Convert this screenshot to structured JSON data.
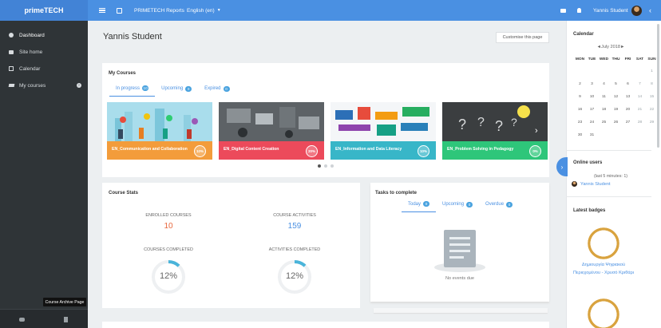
{
  "topbar": {
    "brand": "primeTECH",
    "reports_link": "PRIMETECH Reports",
    "language": "English (en)",
    "user_name": "Yannis Student"
  },
  "sidebar": {
    "items": [
      {
        "label": "Dashboard",
        "icon": "dashboard-icon"
      },
      {
        "label": "Site home",
        "icon": "home-icon"
      },
      {
        "label": "Calendar",
        "icon": "calendar-icon"
      },
      {
        "label": "My courses",
        "icon": "graduation-cap-icon"
      }
    ],
    "tooltip": "Course Archive Page"
  },
  "main": {
    "title": "Yannis Student",
    "customise_button": "Customise this page",
    "my_courses": {
      "title": "My Courses",
      "tabs": [
        {
          "label": "In progress",
          "count": "10"
        },
        {
          "label": "Upcoming",
          "count": "0"
        },
        {
          "label": "Expired",
          "count": "0"
        }
      ],
      "courses": [
        {
          "name": "EN_Communication and Collaboration",
          "progress": "10%",
          "band_color": "#f39c3b"
        },
        {
          "name": "EN_Digital Content Creation",
          "progress": "20%",
          "band_color": "#ec4a5b"
        },
        {
          "name": "EN_Information and Data Literacy",
          "progress": "10%",
          "band_color": "#38b6c8"
        },
        {
          "name": "EN_Problem Solving in Pedagogy",
          "progress": "0%",
          "band_color": "#2ec67a"
        }
      ]
    },
    "course_stats": {
      "title": "Course Stats",
      "enrolled_label": "ENROLLED COURSES",
      "enrolled_value": "10",
      "activities_label": "COURSE ACTIVITIES",
      "activities_value": "159",
      "completed_label": "COURSES COMPLETED",
      "completed_value": "12%",
      "completed_fraction": 0.12,
      "activities_completed_label": "ACTIVITIES COMPLETED",
      "activities_completed_value": "12%",
      "activities_completed_fraction": 0.12
    },
    "tasks": {
      "title": "Tasks to complete",
      "tabs": [
        {
          "label": "Today",
          "count": "0"
        },
        {
          "label": "Upcoming",
          "count": "0"
        },
        {
          "label": "Overdue",
          "count": "0"
        }
      ],
      "empty_text": "No events due"
    }
  },
  "rightbar": {
    "calendar": {
      "title": "Calendar",
      "prev": "◄",
      "month": "July 2018",
      "next": "►",
      "weekdays": [
        "MON",
        "TUE",
        "WED",
        "THU",
        "FRI",
        "SAT",
        "SUN"
      ],
      "weeks": [
        [
          "",
          "",
          "",
          "",
          "",
          "",
          "1"
        ],
        [
          "2",
          "3",
          "4",
          "5",
          "6",
          "7",
          "8"
        ],
        [
          "9",
          "10",
          "11",
          "12",
          "13",
          "14",
          "15"
        ],
        [
          "16",
          "17",
          "18",
          "19",
          "20",
          "21",
          "22"
        ],
        [
          "23",
          "24",
          "25",
          "26",
          "27",
          "28",
          "29"
        ],
        [
          "30",
          "31",
          "",
          "",
          "",
          "",
          ""
        ]
      ]
    },
    "online_users": {
      "title": "Online users",
      "note": "(last 5 minutes: 1)",
      "users": [
        "Yannis Student"
      ]
    },
    "latest_badges": {
      "title": "Latest badges",
      "badge_text": "Δημιουργία Ψηφιακού Περιεχομένου - Χρυσό Κριθάρι"
    }
  },
  "colors": {
    "topbar": "#4a90e2",
    "sidebar": "#2f3437",
    "accent": "#4a90e2",
    "stat_orange": "#e8673c",
    "ring": "#4ab4da"
  }
}
